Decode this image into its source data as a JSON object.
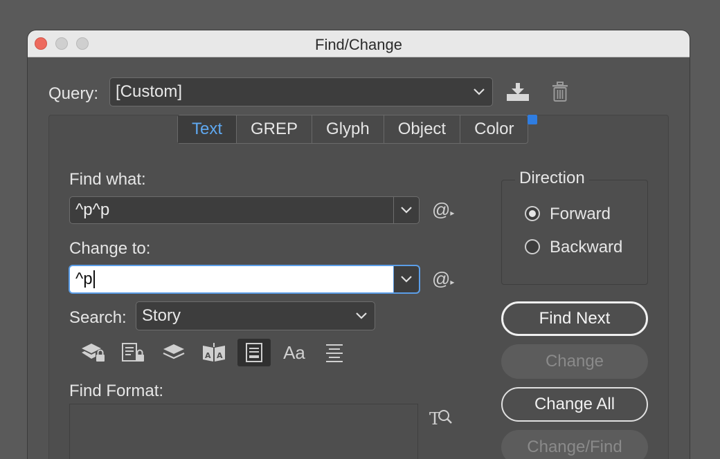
{
  "window": {
    "title": "Find/Change"
  },
  "query": {
    "label": "Query:",
    "value": "[Custom]"
  },
  "tabs": [
    {
      "label": "Text",
      "active": true
    },
    {
      "label": "GREP",
      "active": false
    },
    {
      "label": "Glyph",
      "active": false
    },
    {
      "label": "Object",
      "active": false
    },
    {
      "label": "Color",
      "active": false
    }
  ],
  "find_what": {
    "label": "Find what:",
    "value": "^p^p"
  },
  "change_to": {
    "label": "Change to:",
    "value": "^p"
  },
  "search": {
    "label": "Search:",
    "value": "Story"
  },
  "direction": {
    "label": "Direction",
    "options": [
      {
        "label": "Forward",
        "selected": true
      },
      {
        "label": "Backward",
        "selected": false
      }
    ]
  },
  "buttons": {
    "find_next": "Find Next",
    "change": "Change",
    "change_all": "Change All",
    "change_find": "Change/Find"
  },
  "find_format": {
    "label": "Find Format:"
  },
  "special_char_symbol": "@",
  "case_icon_text": "Aa",
  "icons": [
    "include-locked-layers-icon",
    "include-locked-stories-icon",
    "include-hidden-layers-icon",
    "include-master-pages-icon",
    "include-footnotes-icon",
    "case-sensitive-icon",
    "whole-word-icon"
  ],
  "colors": {
    "accent": "#5fa8f0",
    "focus": "#5b9ee8",
    "close": "#ed6a5e",
    "badge": "#2f7de1"
  }
}
